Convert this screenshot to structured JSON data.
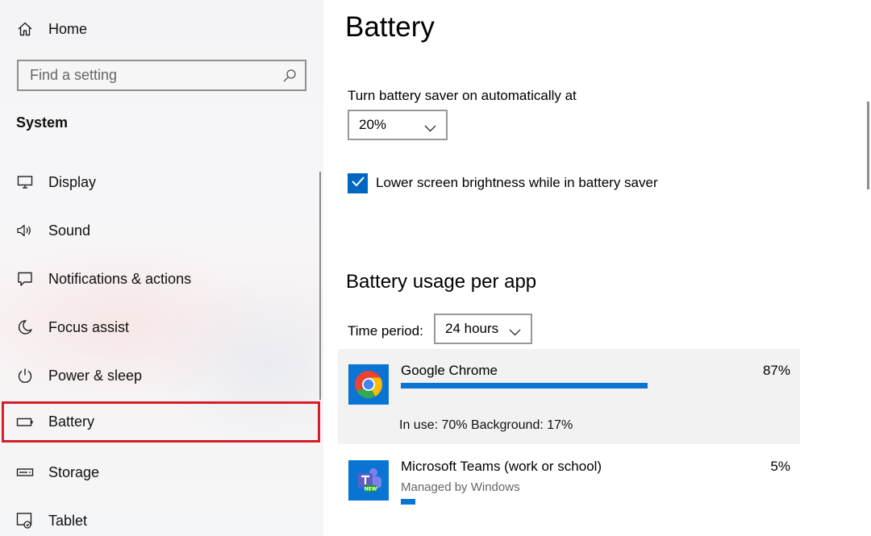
{
  "sidebar": {
    "home_label": "Home",
    "search": {
      "placeholder": "Find a setting"
    },
    "section_title": "System",
    "items": [
      {
        "label": "Display",
        "icon": "monitor-icon"
      },
      {
        "label": "Sound",
        "icon": "speaker-icon"
      },
      {
        "label": "Notifications & actions",
        "icon": "notification-icon"
      },
      {
        "label": "Focus assist",
        "icon": "moon-icon"
      },
      {
        "label": "Power & sleep",
        "icon": "power-icon"
      },
      {
        "label": "Battery",
        "icon": "battery-icon",
        "selected": true
      },
      {
        "label": "Storage",
        "icon": "storage-icon"
      },
      {
        "label": "Tablet",
        "icon": "tablet-icon"
      }
    ],
    "highlight_color": "#d31f27"
  },
  "main": {
    "title": "Battery",
    "saver_label": "Turn battery saver on automatically at",
    "saver_value": "20%",
    "brightness_label": "Lower screen brightness while in battery saver",
    "brightness_checked": true,
    "usage_heading": "Battery usage per app",
    "time_period_label": "Time period:",
    "time_period_value": "24 hours",
    "accent_color": "#0067c0",
    "apps": [
      {
        "name": "Google Chrome",
        "percent": "87%",
        "usage_fraction": 0.87,
        "detail": "In use: 70%  Background: 17%",
        "icon": "chrome-icon"
      },
      {
        "name": "Microsoft Teams (work or school)",
        "percent": "5%",
        "usage_fraction": 0.05,
        "sub": "Managed by Windows",
        "icon": "teams-icon"
      }
    ]
  }
}
